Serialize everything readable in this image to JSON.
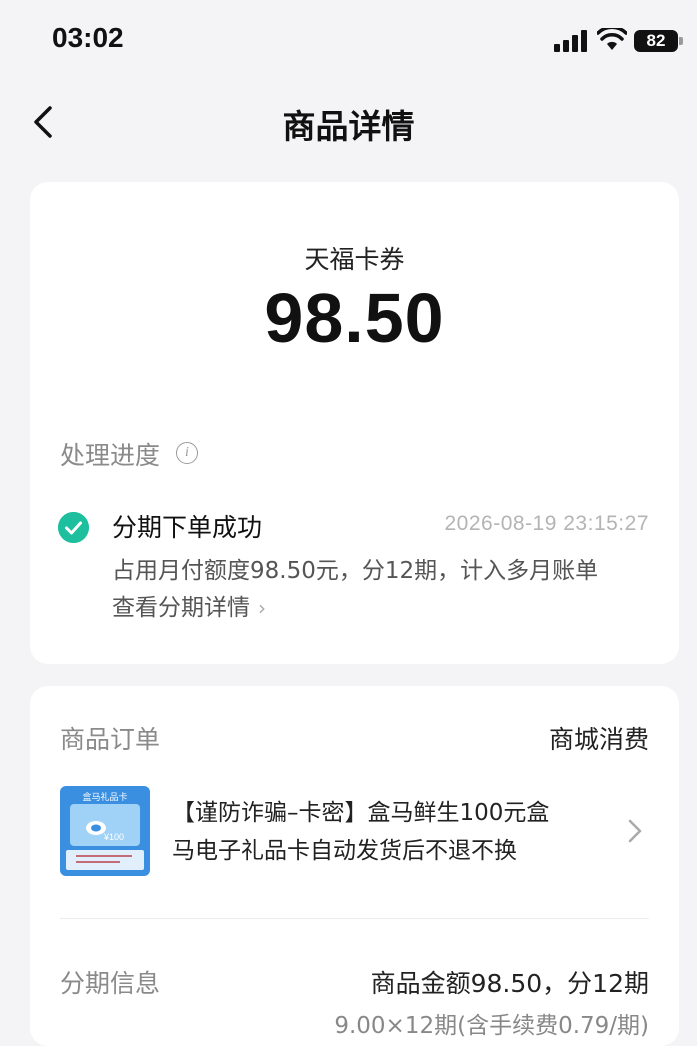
{
  "status_bar": {
    "time": "03:02",
    "battery_level": "82",
    "icons": [
      "signal-icon",
      "wifi-icon",
      "battery-icon"
    ]
  },
  "nav": {
    "back_icon": "chevron-left-icon",
    "title": "商品详情"
  },
  "summary": {
    "merchant": "天福卡券",
    "amount": "98.50"
  },
  "progress": {
    "label": "处理进度",
    "info_icon": "info-icon",
    "step": {
      "status_icon": "check-circle-icon",
      "title": "分期下单成功",
      "time": "2026-08-19 23:15:27",
      "description": "占用月付额度98.50元，分12期，计入多月账单",
      "link": "查看分期详情"
    }
  },
  "order": {
    "label": "商品订单",
    "type": "商城消费",
    "product": {
      "thumb_title": "盒马礼品卡",
      "thumb_price": "¥100",
      "name_line1": "【谨防诈骗–卡密】盒马鲜生100元盒",
      "name_line2": "马电子礼品卡自动发货后不退不换"
    }
  },
  "installment": {
    "label": "分期信息",
    "summary": "商品金额98.50，分12期",
    "detail": "9.00×12期(含手续费0.79/期)"
  },
  "colors": {
    "accent": "#1dbf9f",
    "background": "#f4f4f6",
    "card": "#ffffff"
  }
}
